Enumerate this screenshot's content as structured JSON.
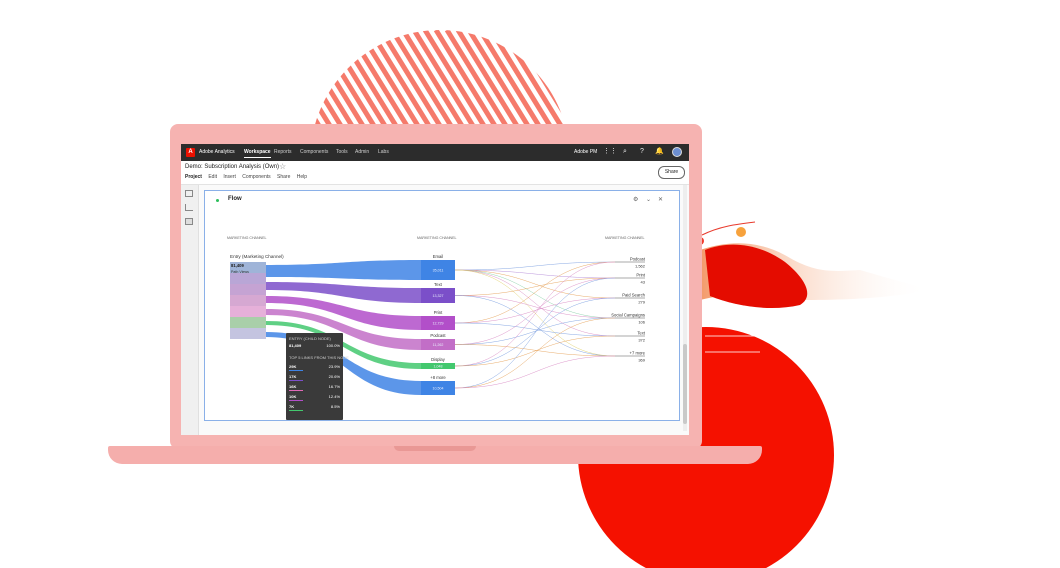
{
  "app": {
    "brand": "Adobe Analytics",
    "nav": [
      "Workspace",
      "Reports",
      "Components",
      "Tools",
      "Admin",
      "Labs"
    ],
    "active_nav": "Workspace",
    "org": "Adobe PM",
    "icons": [
      "apps-grid-icon",
      "search-icon",
      "help-icon",
      "bell-icon",
      "avatar"
    ]
  },
  "project": {
    "title": "Demo: Subscription Analysis (Own)",
    "menu": [
      "Project",
      "Edit",
      "Insert",
      "Components",
      "Share",
      "Help"
    ],
    "share_label": "Share"
  },
  "panel": {
    "title": "Flow",
    "status_color": "#2dbf5c"
  },
  "flow": {
    "column_headers": [
      "MARKETING CHANNEL",
      "MARKETING CHANNEL",
      "MARKETING CHANNEL"
    ],
    "entry": {
      "label": "Entry (Marketing Channel)",
      "value": "81,409",
      "sub": "Path Views"
    },
    "middle_nodes": [
      {
        "label": "Email",
        "value": "35,011",
        "color": "#3f84e5"
      },
      {
        "label": "Text",
        "value": "13,327",
        "color": "#7b4fc9"
      },
      {
        "label": "Print",
        "value": "12,729",
        "color": "#b24fc9"
      },
      {
        "label": "Podcast",
        "value": "11,262",
        "color": "#c26ec7"
      },
      {
        "label": "Display",
        "value": "1,048",
        "color": "#43c86e"
      },
      {
        "label": "+8 more",
        "value": "10,504",
        "color": "#3f84e5"
      }
    ],
    "right_nodes": [
      {
        "label": "Podcast",
        "value": "1,562"
      },
      {
        "label": "Print",
        "value": "43"
      },
      {
        "label": "Paid Search",
        "value": "279"
      },
      {
        "label": "Social Campaigns",
        "value": "106"
      },
      {
        "label": "Text",
        "value": "372"
      },
      {
        "label": "+7 more",
        "value": "369"
      }
    ],
    "colors": {
      "blue": "#3f84e5",
      "purple": "#7b4fc9",
      "magenta": "#b24fc9",
      "pink": "#e06ab8",
      "green": "#43c86e"
    }
  },
  "tooltip": {
    "header": "ENTRY (CHILD NODE)",
    "total_value": "81,409",
    "total_pct": "100.0%",
    "subheader": "TOP 5 LINKS FROM THIS NODE",
    "rows": [
      {
        "k": "29K",
        "v": "23.9%",
        "color": "#3f84e5"
      },
      {
        "k": "17K",
        "v": "20.6%",
        "color": "#7b4fc9"
      },
      {
        "k": "16K",
        "v": "16.7%",
        "color": "#e06ab8"
      },
      {
        "k": "10K",
        "v": "12.4%",
        "color": "#b24fc9"
      },
      {
        "k": "7K",
        "v": "8.5%",
        "color": "#43c86e"
      }
    ]
  }
}
